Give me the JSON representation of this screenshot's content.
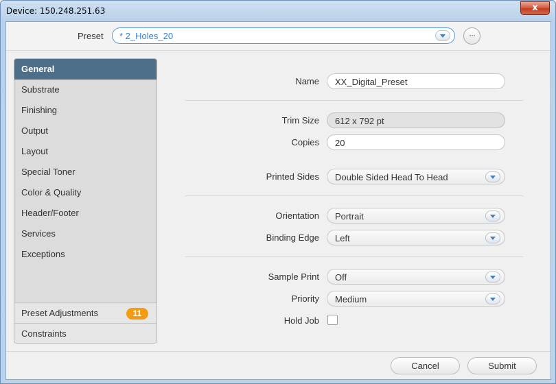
{
  "window": {
    "title": "Device: 150.248.251.63",
    "close_label": "x"
  },
  "preset": {
    "label": "Preset",
    "value": "* 2_Holes_20",
    "more_label": "···"
  },
  "sidebar": {
    "items": [
      {
        "label": "General",
        "active": true
      },
      {
        "label": "Substrate"
      },
      {
        "label": "Finishing"
      },
      {
        "label": "Output"
      },
      {
        "label": "Layout"
      },
      {
        "label": "Special Toner"
      },
      {
        "label": "Color & Quality"
      },
      {
        "label": "Header/Footer"
      },
      {
        "label": "Services"
      },
      {
        "label": "Exceptions"
      }
    ],
    "preset_adjustments": {
      "label": "Preset Adjustments",
      "badge": "11"
    },
    "constraints": {
      "label": "Constraints"
    }
  },
  "form": {
    "name": {
      "label": "Name",
      "value": "XX_Digital_Preset"
    },
    "trim_size": {
      "label": "Trim Size",
      "value": "612 x 792 pt"
    },
    "copies": {
      "label": "Copies",
      "value": "20"
    },
    "printed_sides": {
      "label": "Printed Sides",
      "value": "Double Sided Head To Head"
    },
    "orientation": {
      "label": "Orientation",
      "value": "Portrait"
    },
    "binding_edge": {
      "label": "Binding Edge",
      "value": "Left"
    },
    "sample_print": {
      "label": "Sample Print",
      "value": "Off"
    },
    "priority": {
      "label": "Priority",
      "value": "Medium"
    },
    "hold_job": {
      "label": "Hold Job",
      "checked": false
    }
  },
  "footer": {
    "cancel_label": "Cancel",
    "submit_label": "Submit"
  },
  "colors": {
    "accent": "#4e6f89",
    "badge": "#f39c12",
    "link": "#3a7fc1"
  }
}
